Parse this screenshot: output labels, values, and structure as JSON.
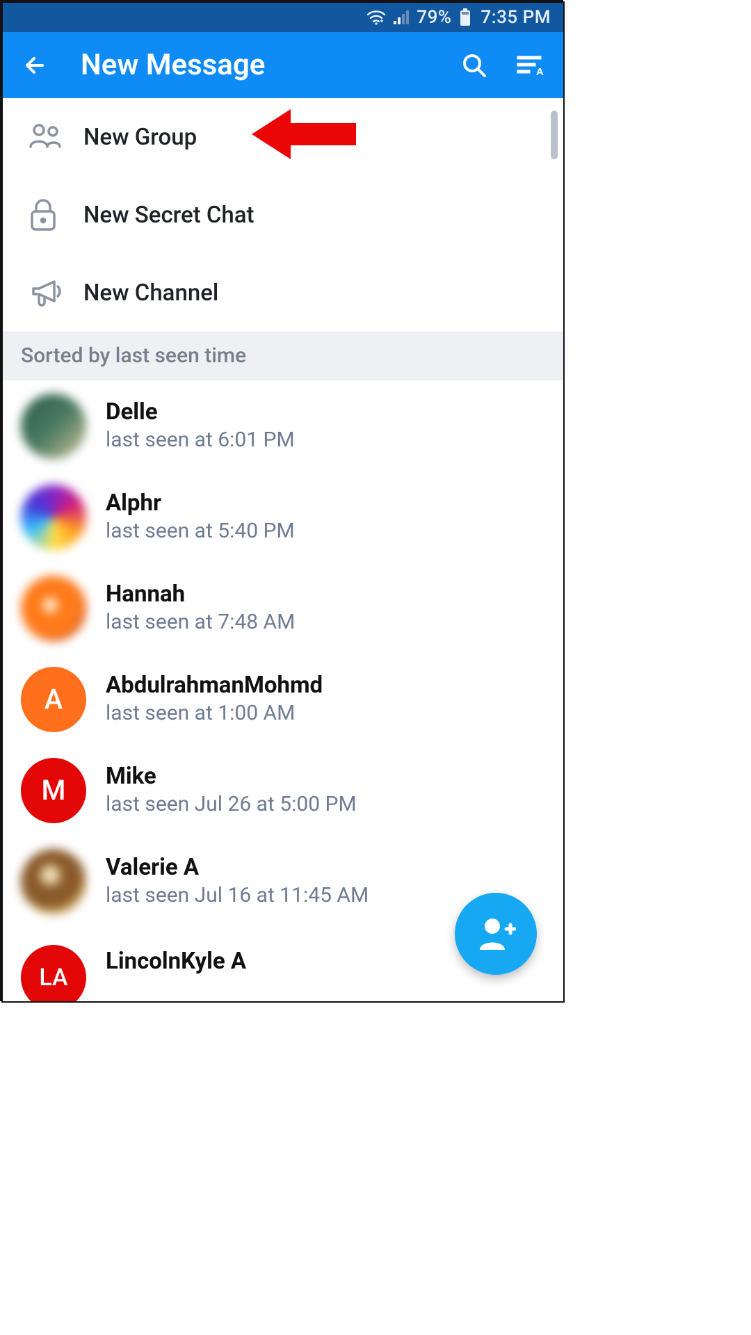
{
  "status_bar": {
    "battery_text": "79%",
    "time_text": "7:35 PM"
  },
  "app_bar": {
    "title": "New Message"
  },
  "actions": {
    "new_group_label": "New Group",
    "new_secret_chat_label": "New Secret Chat",
    "new_channel_label": "New Channel"
  },
  "section_header": "Sorted by last seen time",
  "contacts": [
    {
      "name": "Delle",
      "status": "last seen at 6:01 PM",
      "avatar_type": "photo",
      "initial": "",
      "avatar_class": "av0"
    },
    {
      "name": "Alphr",
      "status": "last seen at 5:40 PM",
      "avatar_type": "photo",
      "initial": "",
      "avatar_class": "av1"
    },
    {
      "name": "Hannah",
      "status": "last seen at 7:48 AM",
      "avatar_type": "photo",
      "initial": "",
      "avatar_class": "av2"
    },
    {
      "name": "AbdulrahmanMohmd",
      "status": "last seen at 1:00 AM",
      "avatar_type": "initial",
      "initial": "A",
      "avatar_class": "av3"
    },
    {
      "name": "Mike",
      "status": "last seen Jul 26 at 5:00 PM",
      "avatar_type": "initial",
      "initial": "M",
      "avatar_class": "av4"
    },
    {
      "name": "Valerie A",
      "status": "last seen Jul 16 at 11:45 AM",
      "avatar_type": "photo",
      "initial": "",
      "avatar_class": "av5"
    },
    {
      "name": "LincolnKyle A",
      "status": "",
      "avatar_type": "initial",
      "initial": "LA",
      "avatar_class": "av6"
    }
  ]
}
